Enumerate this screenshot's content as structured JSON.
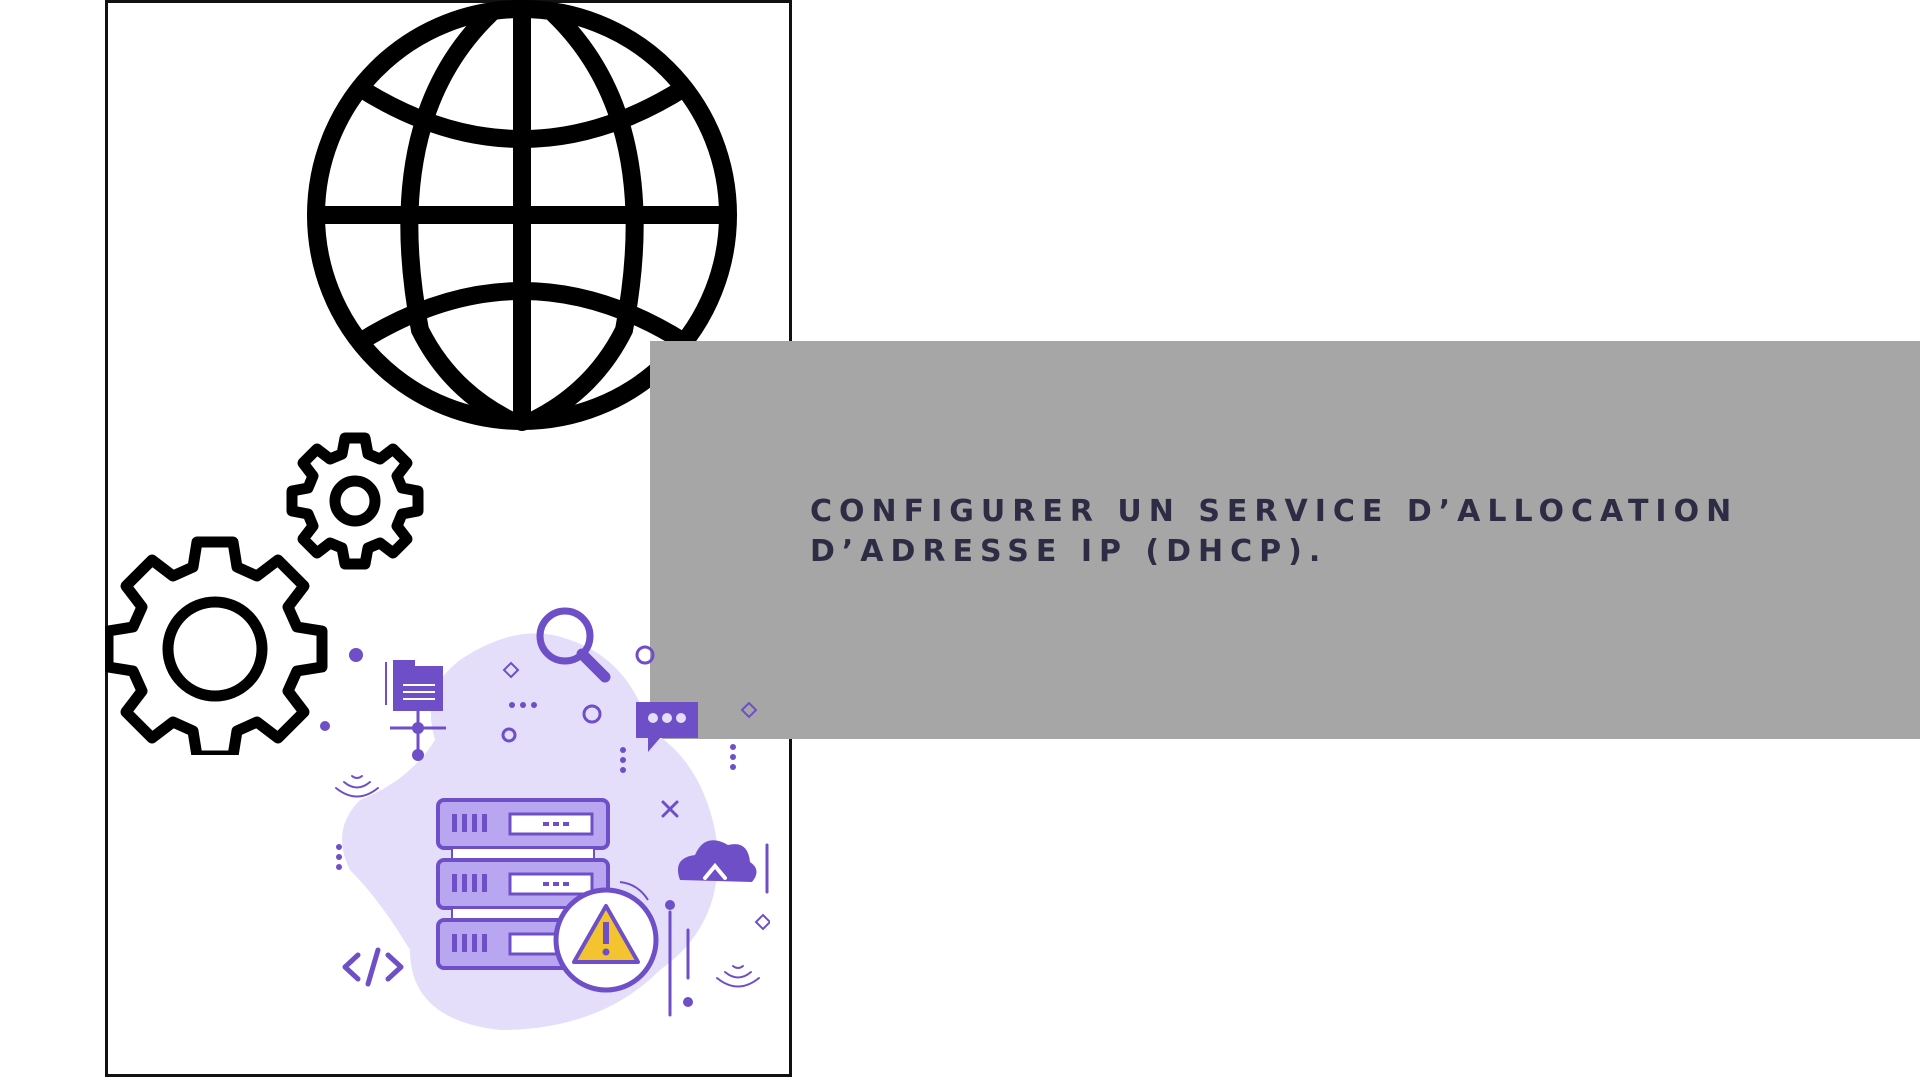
{
  "slide": {
    "title_line1": "CONFIGURER UN SERVICE D’ALLOCATION",
    "title_line2": "D’ADRESSE IP (DHCP)."
  },
  "icons": {
    "globe": "globe-icon",
    "gears": "gears-icon",
    "server_alert": "server-warning-illustration"
  },
  "colors": {
    "banner": "#a6a6a6",
    "title_text": "#2e2c45",
    "accent_purple": "#6e4fc7",
    "light_purple": "#e4defa",
    "warning_yellow": "#f4c430",
    "outline": "#111111"
  }
}
